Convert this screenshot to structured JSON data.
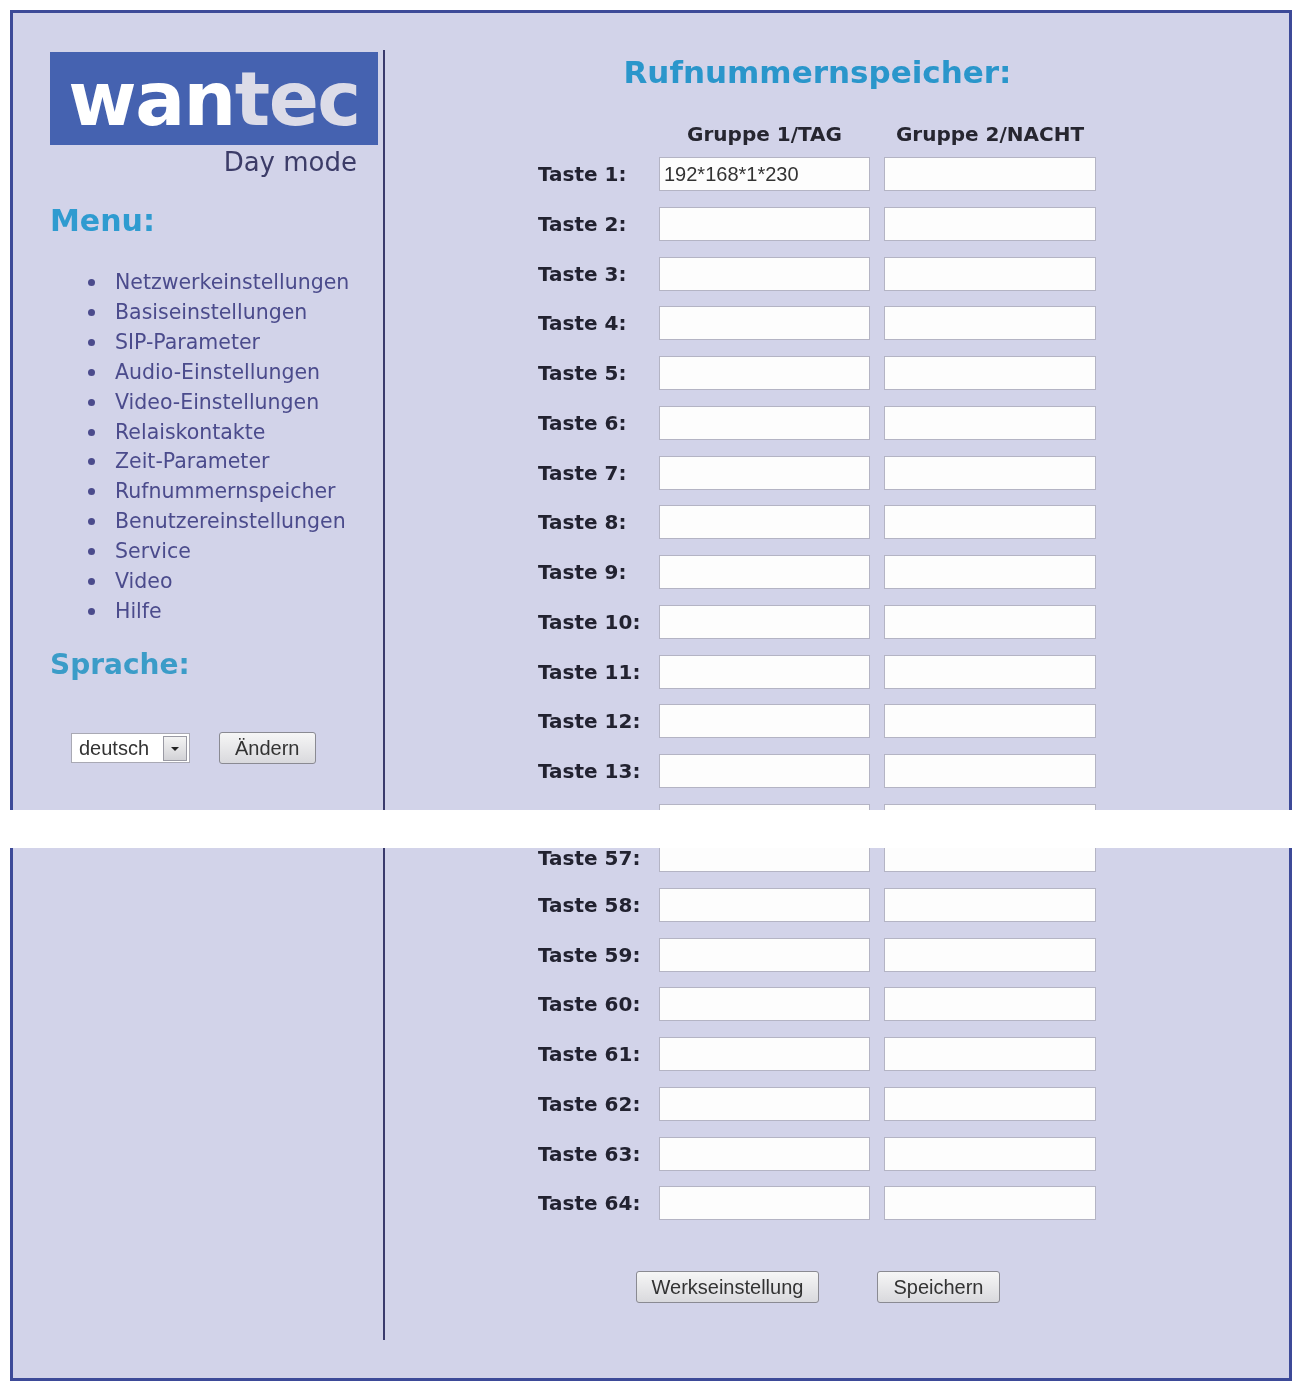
{
  "top_part": {
    "logo": {
      "main": "wan",
      "accent": "tec"
    },
    "mode_label": "Day mode",
    "sidebar": {
      "menu_title": "Menu:",
      "menu_items": [
        "Netzwerkeinstellungen",
        "Basiseinstellungen",
        "SIP-Parameter",
        "Audio-Einstellungen",
        "Video-Einstellungen",
        "Relaiskontakte",
        "Zeit-Parameter",
        "Rufnummernspeicher",
        "Benutzereinstellungen",
        "Service",
        "Video",
        "Hilfe"
      ],
      "language_title": "Sprache:",
      "language_select": {
        "value": "deutsch"
      },
      "language_button": "Ändern"
    },
    "title": "Rufnummernspeicher:",
    "columns": [
      "Gruppe 1/TAG",
      "Gruppe 2/NACHT"
    ],
    "rows": [
      {
        "kind": "full",
        "label": "Taste 1:",
        "group_1": "192*168*1*230"
      },
      {
        "kind": "full",
        "label": "Taste 2:"
      },
      {
        "kind": "full",
        "label": "Taste 3:"
      },
      {
        "kind": "full",
        "label": "Taste 4:"
      },
      {
        "kind": "full",
        "label": "Taste 5:"
      },
      {
        "kind": "full",
        "label": "Taste 6:"
      },
      {
        "kind": "full",
        "label": "Taste 7:"
      },
      {
        "kind": "full",
        "label": "Taste 8:"
      },
      {
        "kind": "full",
        "label": "Taste 9:"
      },
      {
        "kind": "full",
        "label": "Taste 10:"
      },
      {
        "kind": "full",
        "label": "Taste 11:"
      },
      {
        "kind": "full",
        "label": "Taste 12:"
      },
      {
        "kind": "full",
        "label": "Taste 13:"
      },
      {
        "kind": "cut_bottom"
      }
    ]
  },
  "bottom_part": {
    "rows": [
      {
        "kind": "cut_top",
        "label": "Taste 57:"
      },
      {
        "kind": "full",
        "label": "Taste 58:"
      },
      {
        "kind": "full",
        "label": "Taste 59:"
      },
      {
        "kind": "full",
        "label": "Taste 60:"
      },
      {
        "kind": "full",
        "label": "Taste 61:"
      },
      {
        "kind": "full",
        "label": "Taste 62:"
      },
      {
        "kind": "full",
        "label": "Taste 63:"
      },
      {
        "kind": "full",
        "label": "Taste 64:"
      }
    ],
    "buttons": [
      "Werkseinstellung",
      "Speichern"
    ]
  }
}
